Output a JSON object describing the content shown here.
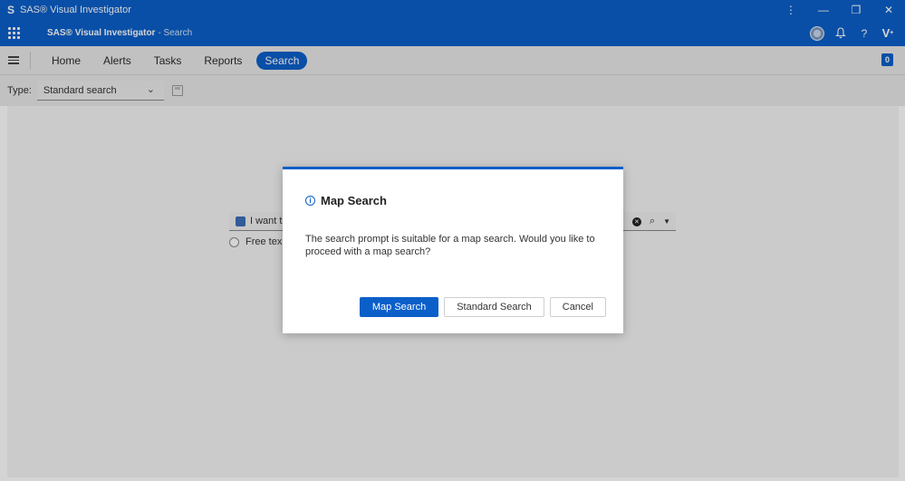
{
  "window": {
    "title": "SAS® Visual Investigator",
    "controls": [
      "⋮",
      "—",
      "❐",
      "✕"
    ]
  },
  "header": {
    "brand": "SAS® Visual Investigator",
    "brand_sub": "- Search",
    "help_label": "?",
    "user_initial": "V"
  },
  "nav": {
    "tabs": [
      {
        "label": "Home"
      },
      {
        "label": "Alerts"
      },
      {
        "label": "Tasks"
      },
      {
        "label": "Reports"
      },
      {
        "label": "Search",
        "active": true
      }
    ],
    "badge_count": "0"
  },
  "toolbar": {
    "type_label": "Type:",
    "type_value": "Standard search"
  },
  "search": {
    "prompt_text": "I want t",
    "radio_label": "Free tex"
  },
  "dialog": {
    "title": "Map Search",
    "message": "The search prompt is suitable for a map search. Would you like to proceed with a map search?",
    "buttons": {
      "primary": "Map Search",
      "secondary": "Standard Search",
      "cancel": "Cancel"
    }
  },
  "colors": {
    "brand_blue": "#0b5fc9",
    "nav_bg": "#e9e9e9"
  }
}
